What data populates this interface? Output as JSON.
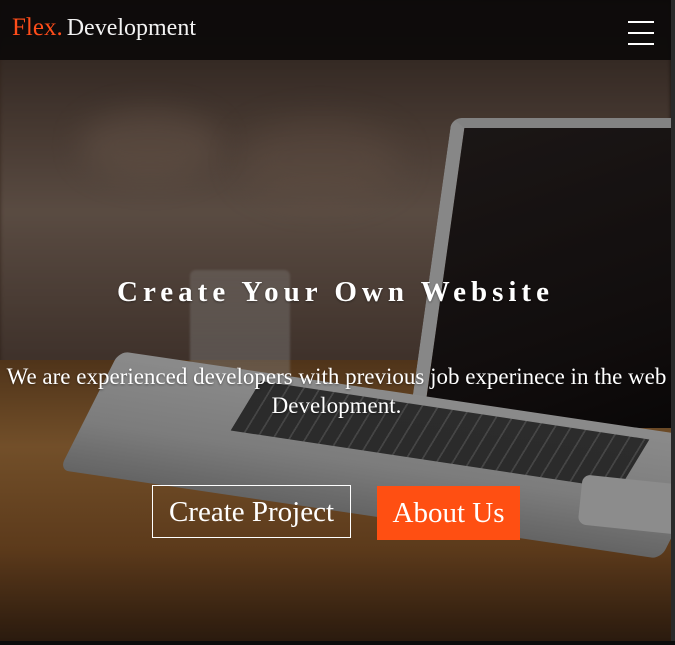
{
  "navbar": {
    "brand_accent": "Flex.",
    "brand_main": "Development",
    "menu_icon": "hamburger-menu-icon"
  },
  "hero": {
    "headline": "Create Your Own Website",
    "subline": "We are experienced developers with previous job experinece in the web Development.",
    "buttons": {
      "create_project": "Create Project",
      "about_us": "About Us"
    }
  },
  "colors": {
    "accent": "#ff4f12",
    "navbar_bg": "#0c0a0a",
    "text": "#ffffff"
  }
}
